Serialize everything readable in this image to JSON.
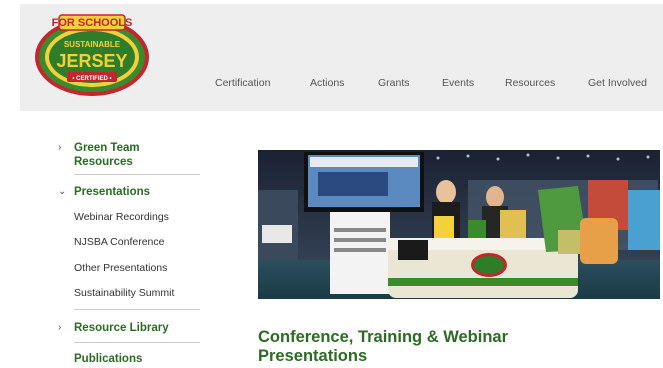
{
  "logo": {
    "top_text": "FOR SCHOOLS",
    "middle_text": "SUSTAINABLE",
    "main_text": "JERSEY",
    "bottom_text": "• CERTIFIED •"
  },
  "nav": [
    {
      "label": "Certification"
    },
    {
      "label": "Actions"
    },
    {
      "label": "Grants"
    },
    {
      "label": "Events"
    },
    {
      "label": "Resources"
    },
    {
      "label": "Get Involved"
    }
  ],
  "sidebar": {
    "green_team": "Green Team Resources",
    "presentations": "Presentations",
    "sub_items": [
      {
        "label": "Webinar Recordings"
      },
      {
        "label": "NJSBA Conference"
      },
      {
        "label": "Other Presentations"
      },
      {
        "label": "Sustainability Summit"
      }
    ],
    "resource_library": "Resource Library",
    "publications": "Publications"
  },
  "main": {
    "heading": "Conference, Training & Webinar Presentations"
  },
  "colors": {
    "brand_green": "#2d6a26",
    "header_bg": "#eeeeee",
    "logo_green": "#3b8a2e",
    "logo_red": "#c4262e",
    "logo_yellow": "#f3d13a"
  }
}
